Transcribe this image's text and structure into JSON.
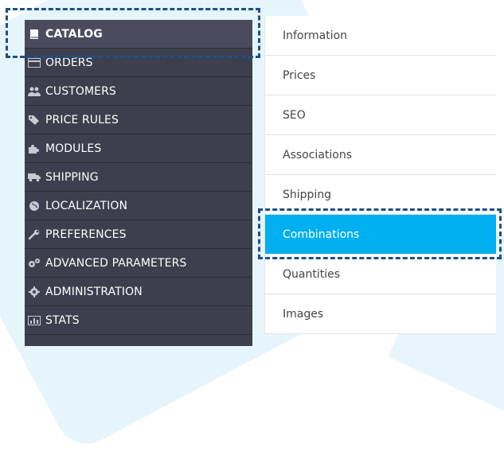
{
  "sidebar": {
    "items": [
      {
        "label": "CATALOG",
        "icon": "book-icon",
        "active": true
      },
      {
        "label": "ORDERS",
        "icon": "credit-card-icon"
      },
      {
        "label": "CUSTOMERS",
        "icon": "users-icon"
      },
      {
        "label": "PRICE RULES",
        "icon": "tags-icon"
      },
      {
        "label": "MODULES",
        "icon": "puzzle-icon"
      },
      {
        "label": "SHIPPING",
        "icon": "truck-icon"
      },
      {
        "label": "LOCALIZATION",
        "icon": "globe-icon"
      },
      {
        "label": "PREFERENCES",
        "icon": "wrench-icon"
      },
      {
        "label": "ADVANCED PARAMETERS",
        "icon": "cogs-icon"
      },
      {
        "label": "ADMINISTRATION",
        "icon": "cog-icon"
      },
      {
        "label": "STATS",
        "icon": "bar-chart-icon"
      }
    ]
  },
  "submenu": {
    "items": [
      {
        "label": "Information"
      },
      {
        "label": "Prices"
      },
      {
        "label": "SEO"
      },
      {
        "label": "Associations"
      },
      {
        "label": "Shipping"
      },
      {
        "label": "Combinations",
        "selected": true
      },
      {
        "label": "Quantities"
      },
      {
        "label": "Images"
      }
    ]
  },
  "colors": {
    "sidebar_bg": "#3d3e4e",
    "selected_bg": "#00aff0",
    "highlight_dash": "#1e4f86"
  }
}
